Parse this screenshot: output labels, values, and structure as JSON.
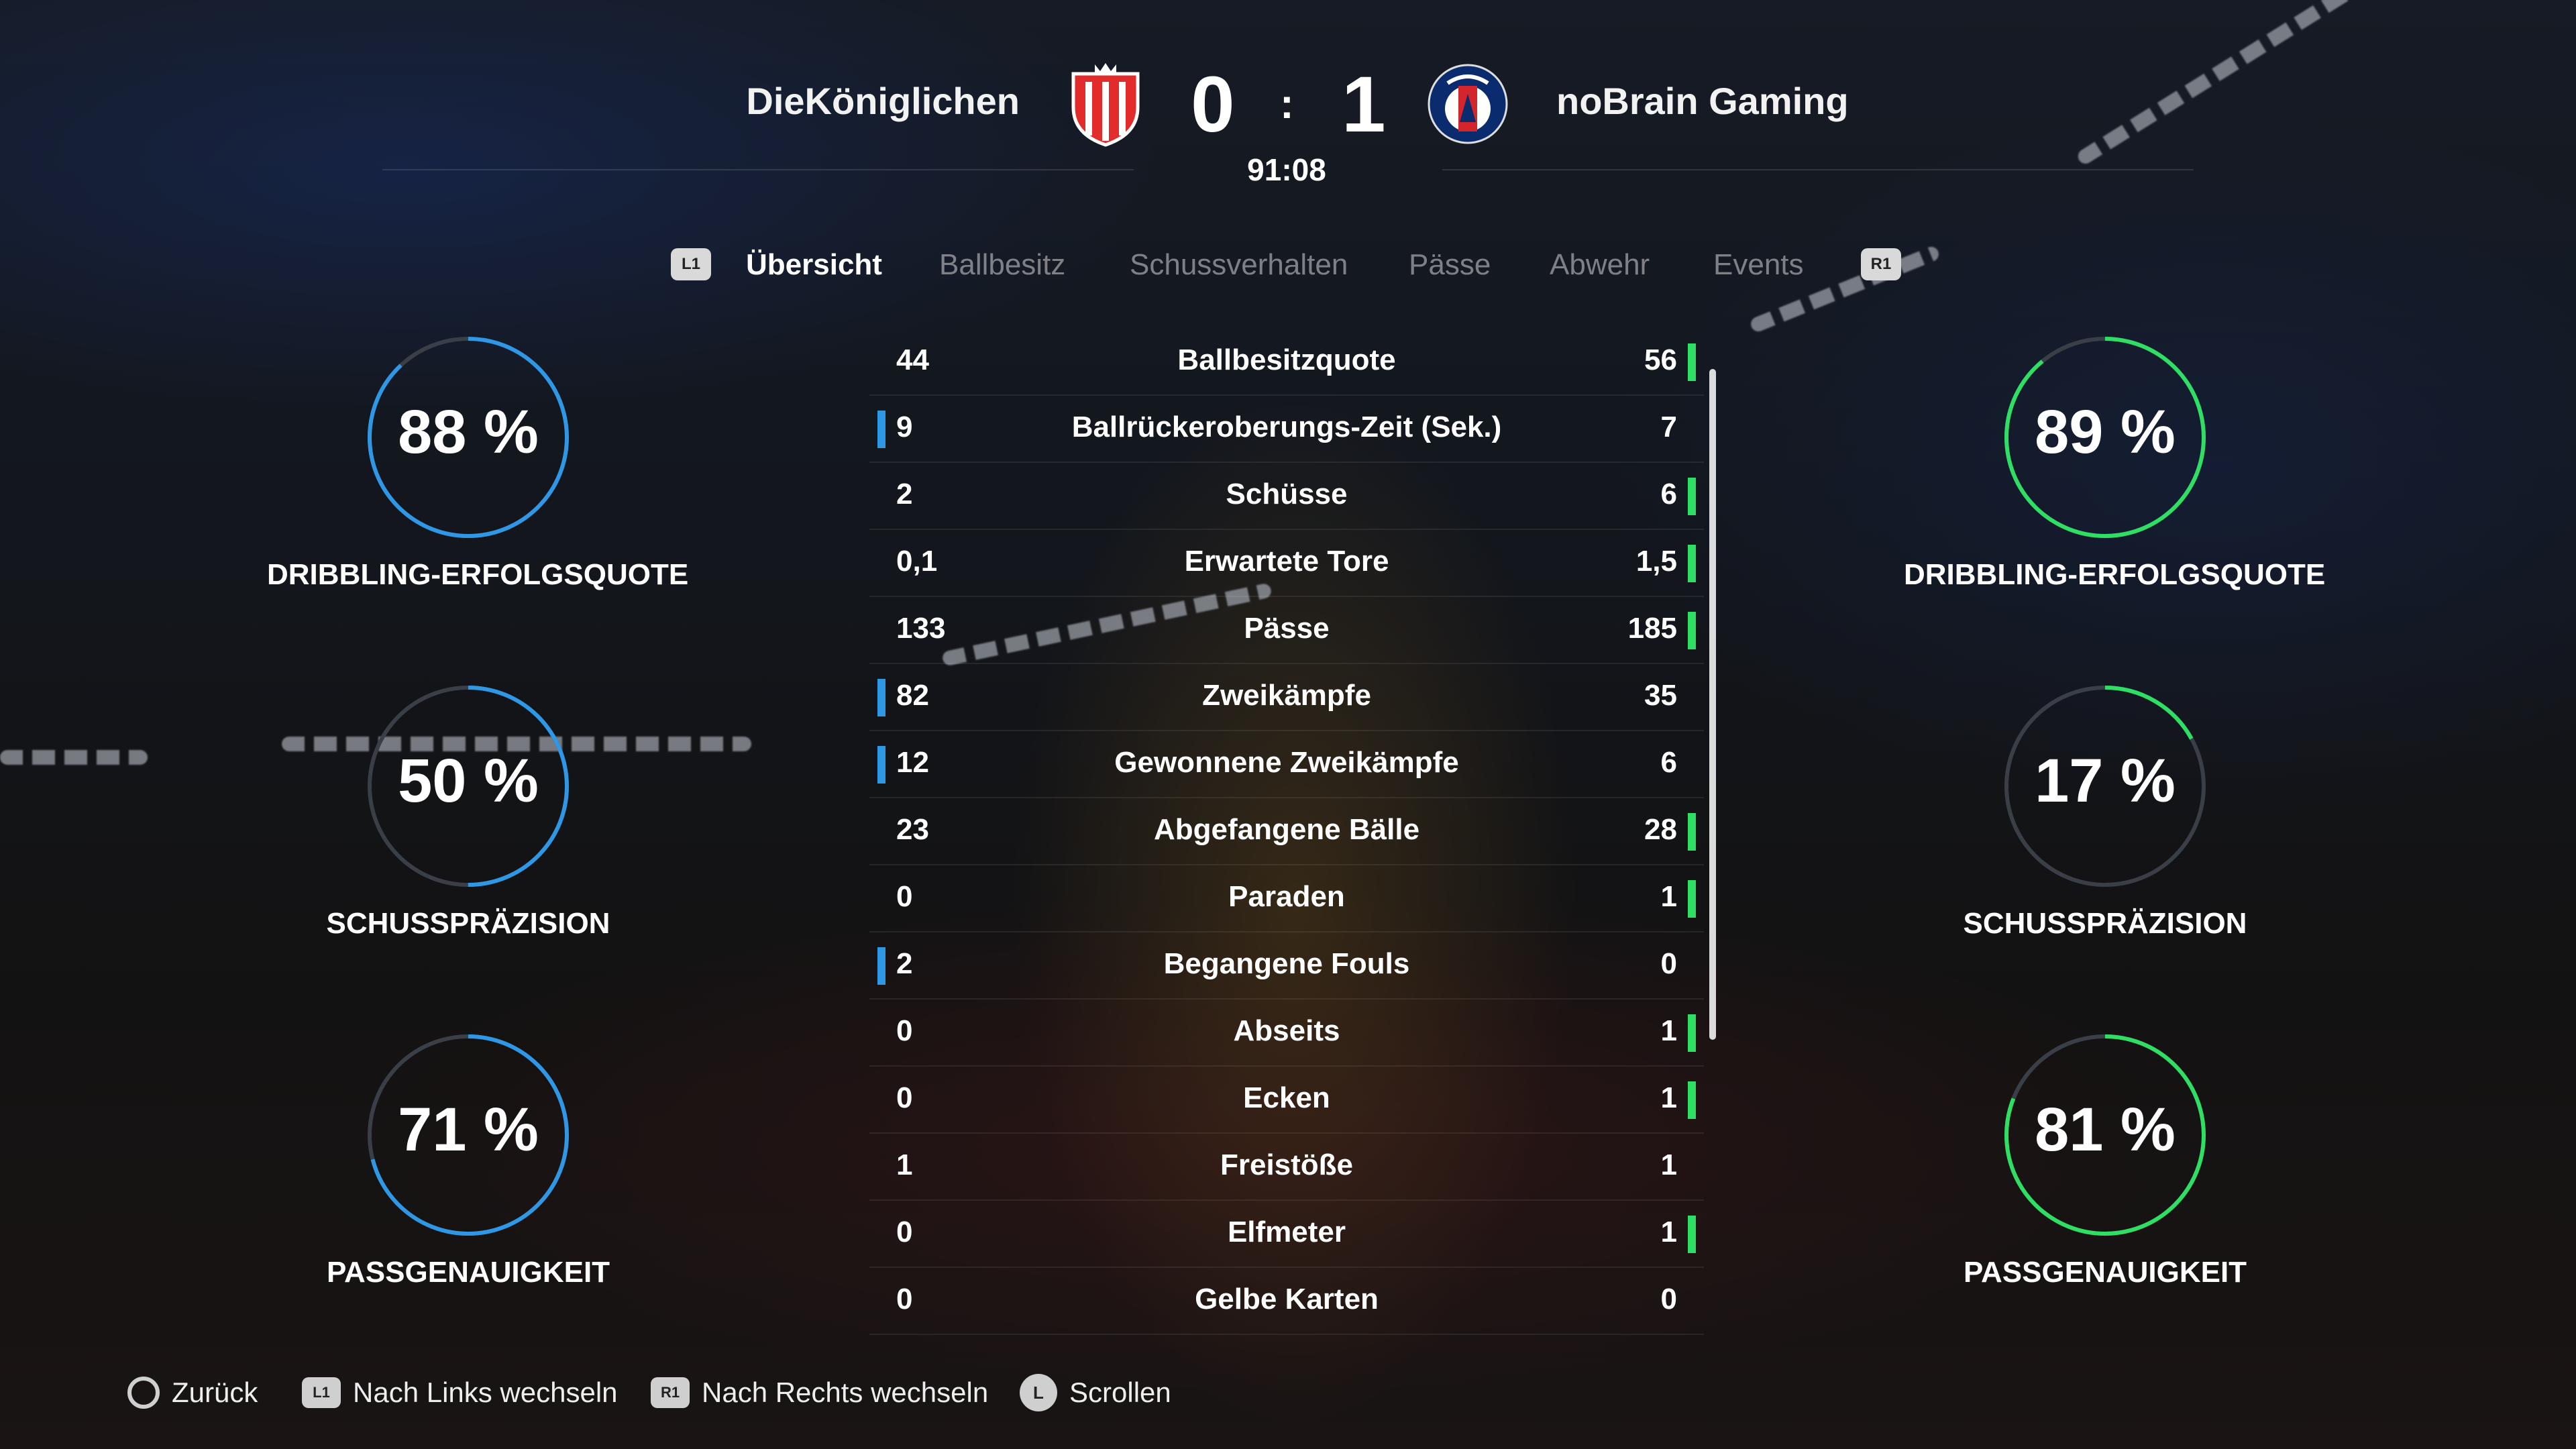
{
  "colors": {
    "home": "#2f98e6",
    "away": "#2fdf63",
    "ring_track": "#3a3f47"
  },
  "match": {
    "home_team": "DieKöniglichen",
    "away_team": "noBrain Gaming",
    "home_score": "0",
    "separator": ":",
    "away_score": "1",
    "clock": "91:08"
  },
  "tabs": {
    "left_button": "L1",
    "right_button": "R1",
    "items": [
      "Übersicht",
      "Ballbesitz",
      "Schussverhalten",
      "Pässe",
      "Abwehr",
      "Events"
    ],
    "active_index": 0
  },
  "stats": [
    {
      "label": "Ballbesitzquote",
      "home": "44",
      "away": "56",
      "leader": "away"
    },
    {
      "label": "Ballrückeroberungs-Zeit (Sek.)",
      "home": "9",
      "away": "7",
      "leader": "home"
    },
    {
      "label": "Schüsse",
      "home": "2",
      "away": "6",
      "leader": "away"
    },
    {
      "label": "Erwartete Tore",
      "home": "0,1",
      "away": "1,5",
      "leader": "away"
    },
    {
      "label": "Pässe",
      "home": "133",
      "away": "185",
      "leader": "away"
    },
    {
      "label": "Zweikämpfe",
      "home": "82",
      "away": "35",
      "leader": "home"
    },
    {
      "label": "Gewonnene Zweikämpfe",
      "home": "12",
      "away": "6",
      "leader": "home"
    },
    {
      "label": "Abgefangene Bälle",
      "home": "23",
      "away": "28",
      "leader": "away"
    },
    {
      "label": "Paraden",
      "home": "0",
      "away": "1",
      "leader": "away"
    },
    {
      "label": "Begangene Fouls",
      "home": "2",
      "away": "0",
      "leader": "home"
    },
    {
      "label": "Abseits",
      "home": "0",
      "away": "1",
      "leader": "away"
    },
    {
      "label": "Ecken",
      "home": "0",
      "away": "1",
      "leader": "away"
    },
    {
      "label": "Freistöße",
      "home": "1",
      "away": "1",
      "leader": "none"
    },
    {
      "label": "Elfmeter",
      "home": "0",
      "away": "1",
      "leader": "away"
    },
    {
      "label": "Gelbe Karten",
      "home": "0",
      "away": "0",
      "leader": "none"
    }
  ],
  "gauges": {
    "home": [
      {
        "value": 88,
        "text": "88 %",
        "label": "DRIBBLING-ERFOLGSQUOTE"
      },
      {
        "value": 50,
        "text": "50 %",
        "label": "SCHUSSPRÄZISION"
      },
      {
        "value": 71,
        "text": "71 %",
        "label": "PASSGENAUIGKEIT"
      }
    ],
    "away": [
      {
        "value": 89,
        "text": "89 %",
        "label": "DRIBBLING-ERFOLGSQUOTE"
      },
      {
        "value": 17,
        "text": "17 %",
        "label": "SCHUSSPRÄZISION"
      },
      {
        "value": 81,
        "text": "81 %",
        "label": "PASSGENAUIGKEIT"
      }
    ]
  },
  "footer": {
    "back": "Zurück",
    "left_button": "L1",
    "left": "Nach Links wechseln",
    "right_button": "R1",
    "right": "Nach Rechts wechseln",
    "scroll_button": "L",
    "scroll": "Scrollen"
  }
}
